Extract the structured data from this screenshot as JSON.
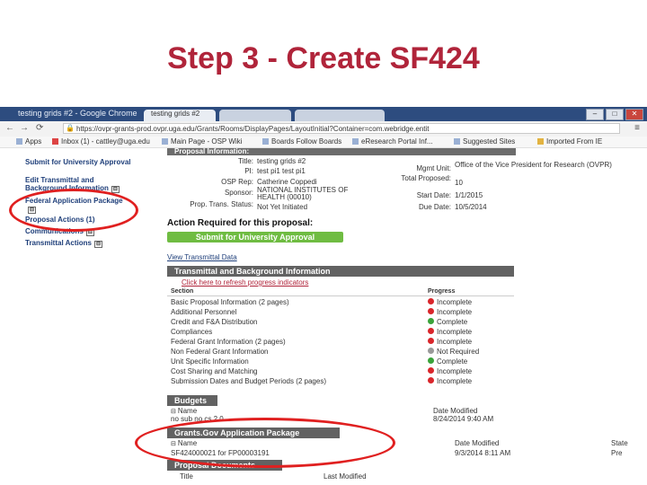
{
  "slide": {
    "title": "Step 3 - Create SF424"
  },
  "browser": {
    "window_title": "testing grids #2 - Google Chrome",
    "tabs": [
      "testing grids #2",
      "",
      ""
    ],
    "url": "https://ovpr-grants-prod.ovpr.uga.edu/Grants/Rooms/DisplayPages/LayoutInitial?Container=com.webridge.entit",
    "bookmarks": [
      "Apps",
      "Inbox (1) - cattley@uga.edu",
      "Main Page - OSP Wiki",
      "Boards Follow Boards",
      "eResearch Portal Inf...",
      "Suggested Sites",
      "Imported From IE"
    ]
  },
  "sidebar": {
    "items": [
      {
        "label": "Submit for University Approval"
      },
      {
        "label": "Edit Transmittal and Background Information"
      },
      {
        "label": "Federal Application Package"
      },
      {
        "label": "Proposal Actions (1)"
      },
      {
        "label": "Communications"
      },
      {
        "label": "Transmittal Actions"
      }
    ]
  },
  "proposal": {
    "header": "Proposal Information:",
    "fields": [
      {
        "label": "Title:",
        "value": "testing grids #2"
      },
      {
        "label": "PI:",
        "value": "test pi1 test pi1"
      },
      {
        "label": "OSP Rep:",
        "value": "Catherine Coppedi"
      },
      {
        "label": "Sponsor:",
        "value": "NATIONAL INSTITUTES OF HEALTH (00010)"
      },
      {
        "label": "Prop. Trans. Status:",
        "value": "Not Yet Initiated"
      }
    ],
    "right_fields": [
      {
        "label": "Mgmt Unit:",
        "value": "Office of the Vice President for Research (OVPR)"
      },
      {
        "label": "Total Proposed:",
        "value": "10"
      },
      {
        "label": "Start Date:",
        "value": "1/1/2015"
      },
      {
        "label": "Due Date:",
        "value": "10/5/2014"
      }
    ]
  },
  "action": {
    "heading": "Action Required for this proposal:",
    "button": "Submit for University Approval",
    "view_link": "View Transmittal Data"
  },
  "transmittal": {
    "header": "Transmittal and Background Information",
    "refresh_link": "Click here to refresh progress indicators",
    "col_section": "Section",
    "col_progress": "Progress",
    "rows": [
      {
        "name": "Basic Proposal Information (2 pages)",
        "status": "Incomplete",
        "color": "#d9262b"
      },
      {
        "name": "Additional Personnel",
        "status": "Incomplete",
        "color": "#d9262b"
      },
      {
        "name": "Credit and F&A Distribution",
        "status": "Complete",
        "color": "#3aa33a"
      },
      {
        "name": "Compliances",
        "status": "Incomplete",
        "color": "#d9262b"
      },
      {
        "name": "Federal Grant Information (2 pages)",
        "status": "Incomplete",
        "color": "#d9262b"
      },
      {
        "name": "Non Federal Grant Information",
        "status": "Not Required",
        "color": "#9a9a9a"
      },
      {
        "name": "Unit Specific Information",
        "status": "Complete",
        "color": "#3aa33a"
      },
      {
        "name": "Cost Sharing and Matching",
        "status": "Incomplete",
        "color": "#d9262b"
      },
      {
        "name": "Submission Dates and Budget Periods (2 pages)",
        "status": "Incomplete",
        "color": "#d9262b"
      }
    ]
  },
  "budgets": {
    "header": "Budgets",
    "col_name": "Name",
    "col_modified": "Date Modified",
    "name": "no sub no cs 2.0",
    "modified": "8/24/2014 9:40 AM"
  },
  "grants": {
    "header": "Grants.Gov Application Package",
    "col_name": "Name",
    "col_modified": "Date Modified",
    "col_state": "State",
    "name": "SF424000021 for FP00003191",
    "modified": "9/3/2014 8:11 AM",
    "state": "Pre"
  },
  "proposal_docs": {
    "header": "Proposal Documents",
    "col_title": "Title",
    "col_modified": "Last Modified"
  },
  "colors": {
    "title": "#b0243a",
    "annotation": "#e02020",
    "green_button": "#6fbc42"
  }
}
